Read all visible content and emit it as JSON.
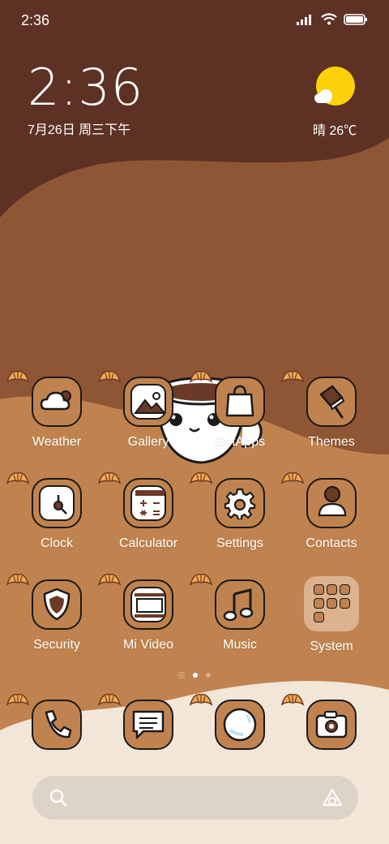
{
  "status_bar": {
    "time": "2:36"
  },
  "clock_widget": {
    "time": "2:36",
    "date": "7月26日 周三下午"
  },
  "weather_widget": {
    "temp": "晴 26℃"
  },
  "apps": [
    {
      "label": "Weather",
      "icon": "weather-icon"
    },
    {
      "label": "Gallery",
      "icon": "gallery-icon"
    },
    {
      "label": "GetApps",
      "icon": "getapps-icon"
    },
    {
      "label": "Themes",
      "icon": "themes-icon"
    },
    {
      "label": "Clock",
      "icon": "clock-icon"
    },
    {
      "label": "Calculator",
      "icon": "calculator-icon"
    },
    {
      "label": "Settings",
      "icon": "gear-icon"
    },
    {
      "label": "Contacts",
      "icon": "contacts-icon"
    },
    {
      "label": "Security",
      "icon": "shield-icon"
    },
    {
      "label": "Mi Video",
      "icon": "video-icon"
    },
    {
      "label": "Music",
      "icon": "music-icon"
    },
    {
      "label": "System",
      "icon": "folder-icon"
    }
  ],
  "dock": [
    {
      "icon": "phone-icon"
    },
    {
      "icon": "messages-icon"
    },
    {
      "icon": "browser-icon"
    },
    {
      "icon": "camera-icon"
    }
  ],
  "page_indicator": {
    "pages": 2,
    "current": 1
  },
  "colors": {
    "dark_brown": "#5d3124",
    "mid_brown": "#8f5635",
    "light_brown": "#c0834f",
    "cream": "#f1e6d8"
  }
}
